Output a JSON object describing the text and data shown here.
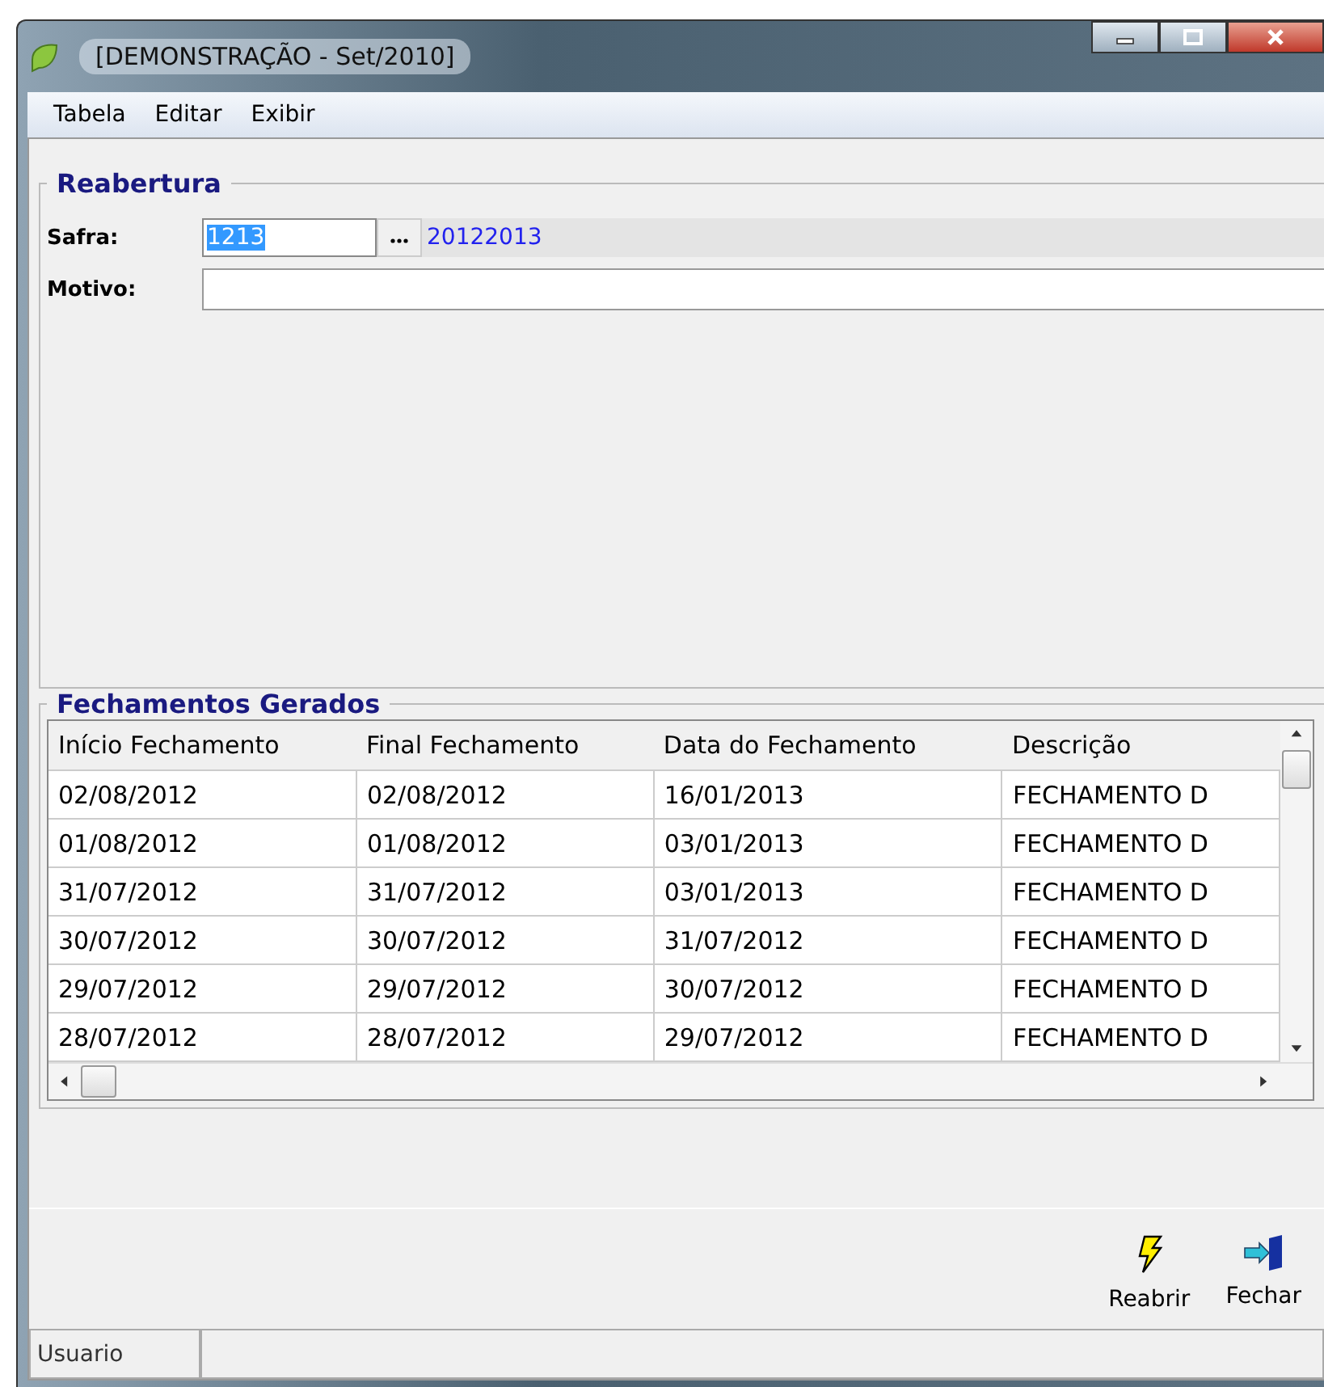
{
  "window": {
    "title": "[DEMONSTRAÇÃO - Set/2010]"
  },
  "menu": [
    {
      "label": "Tabela"
    },
    {
      "label": "Editar"
    },
    {
      "label": "Exibir"
    }
  ],
  "reabertura": {
    "title": "Reabertura",
    "safra": {
      "label": "Safra:",
      "value": "1213",
      "text_selected": true,
      "description": "20122013"
    },
    "motivo": {
      "label": "Motivo:"
    }
  },
  "fechamentos": {
    "title": "Fechamentos Gerados",
    "columns": [
      "Início Fechamento",
      "Final Fechamento",
      "Data do Fechamento",
      "Descrição"
    ],
    "rows": [
      [
        "02/08/2012",
        "02/08/2012",
        "16/01/2013",
        "FECHAMENTO D"
      ],
      [
        "01/08/2012",
        "01/08/2012",
        "03/01/2013",
        "FECHAMENTO D"
      ],
      [
        "31/07/2012",
        "31/07/2012",
        "03/01/2013",
        "FECHAMENTO D"
      ],
      [
        "30/07/2012",
        "30/07/2012",
        "31/07/2012",
        "FECHAMENTO D"
      ],
      [
        "29/07/2012",
        "29/07/2012",
        "30/07/2012",
        "FECHAMENTO D"
      ],
      [
        "28/07/2012",
        "28/07/2012",
        "29/07/2012",
        "FECHAMENTO D"
      ]
    ]
  },
  "buttons": [
    {
      "kind": "reopen",
      "label": "Reabrir"
    },
    {
      "kind": "close",
      "label": "Fechar"
    }
  ],
  "status_bar": [
    "Usuario"
  ]
}
